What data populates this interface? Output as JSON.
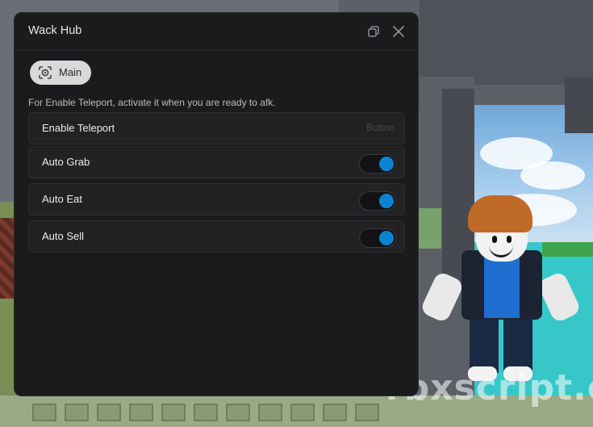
{
  "window": {
    "title": "Wack Hub",
    "controls": {
      "minimize_icon": "restore-window-icon",
      "close_icon": "close-icon"
    }
  },
  "tabs": [
    {
      "label": "Main",
      "icon": "target-icon",
      "selected": true
    }
  ],
  "main": {
    "description": "For Enable Teleport, activate it when you are ready to afk.",
    "items": [
      {
        "type": "button",
        "label": "Enable Teleport",
        "hint": "Button"
      },
      {
        "type": "toggle",
        "label": "Auto Grab",
        "value": true
      },
      {
        "type": "toggle",
        "label": "Auto Eat",
        "value": true
      },
      {
        "type": "toggle",
        "label": "Auto Sell",
        "value": true
      }
    ]
  },
  "colors": {
    "window_bg": "#1b1b1d",
    "row_bg": "#222225",
    "toggle_on": "#0a84d0",
    "tab_bg": "#d9d9d9"
  },
  "background": {
    "watermark": "rbxscript.c"
  }
}
